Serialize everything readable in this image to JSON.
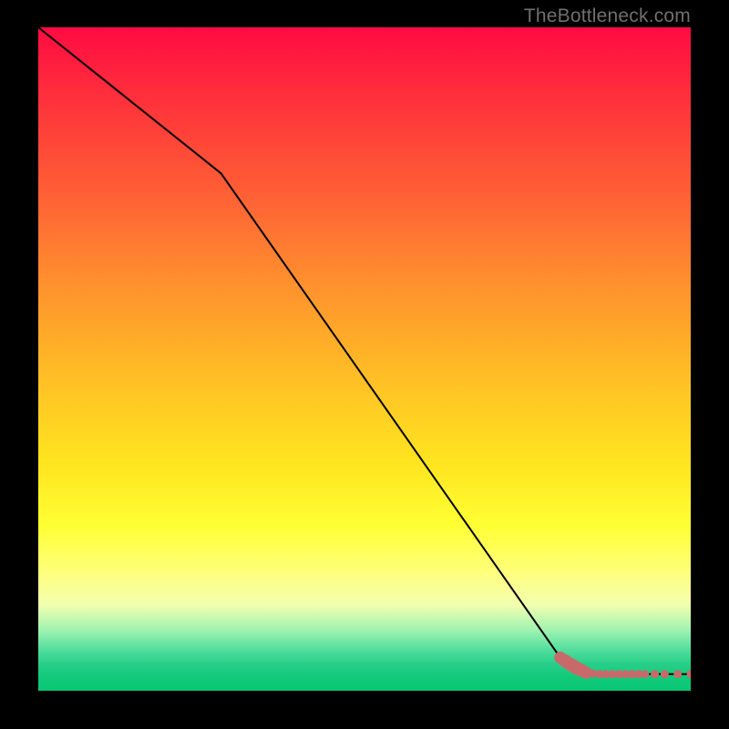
{
  "attribution": "TheBottleneck.com",
  "colors": {
    "gradient_top": "#ff0b42",
    "gradient_mid": "#ffe31f",
    "gradient_bottom": "#08c774",
    "curve": "#000000",
    "points": "#c96a6a",
    "frame_bg": "#000000"
  },
  "chart_data": {
    "type": "line",
    "title": "",
    "xlabel": "",
    "ylabel": "",
    "xlim": [
      0,
      100
    ],
    "ylim": [
      0,
      100
    ],
    "grid": false,
    "legend": false,
    "series": [
      {
        "name": "curve",
        "kind": "line",
        "x": [
          0,
          28,
          80,
          84,
          100
        ],
        "values": [
          100,
          78,
          5,
          2.5,
          2.5
        ]
      },
      {
        "name": "points",
        "kind": "scatter",
        "x": [
          80,
          80.5,
          81,
          81.5,
          82,
          82.5,
          83,
          83.5,
          84,
          85,
          86,
          87,
          88,
          89,
          90,
          91,
          92,
          93,
          94.5,
          96,
          98,
          100
        ],
        "values": [
          5.0,
          4.6,
          4.2,
          3.9,
          3.6,
          3.3,
          3.1,
          2.9,
          2.7,
          2.6,
          2.5,
          2.5,
          2.5,
          2.5,
          2.5,
          2.5,
          2.5,
          2.5,
          2.5,
          2.5,
          2.5,
          2.5
        ]
      }
    ]
  }
}
